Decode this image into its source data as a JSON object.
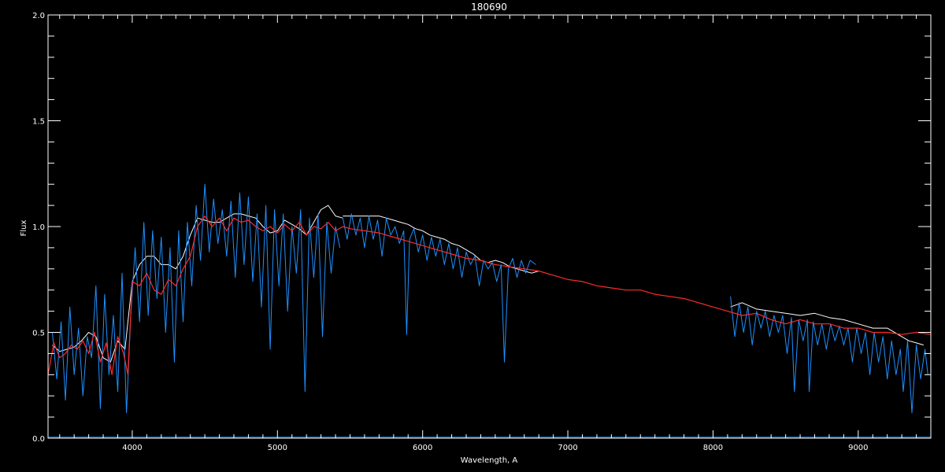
{
  "chart_data": {
    "type": "line",
    "title": "180690",
    "xlabel": "Wavelength, A",
    "ylabel": "Flux",
    "xlim": [
      3420,
      9500
    ],
    "ylim": [
      0.0,
      2.0
    ],
    "x_ticks": [
      4000,
      5000,
      6000,
      7000,
      8000,
      9000
    ],
    "x_tick_labels": [
      "4000",
      "5000",
      "6000",
      "7000",
      "8000",
      "9000"
    ],
    "y_ticks": [
      0.0,
      0.5,
      1.0,
      1.5,
      2.0
    ],
    "y_tick_labels": [
      "0.0",
      "0.5",
      "1.0",
      "1.5",
      "2.0"
    ],
    "background": "#000000",
    "axis_color": "#ffffff",
    "series": [
      {
        "color": "#ffffff",
        "segments": [
          {
            "x": [
              3450,
              3500,
              3550,
              3600,
              3650,
              3700,
              3750,
              3800,
              3850,
              3900,
              3950,
              4000,
              4050,
              4100,
              4150,
              4200,
              4250,
              4300,
              4350,
              4400,
              4450,
              4500,
              4550,
              4600,
              4650,
              4700,
              4750,
              4800,
              4850,
              4900,
              4950,
              5000,
              5050,
              5100,
              5150,
              5200,
              5250,
              5300,
              5350,
              5400,
              5450
            ],
            "y": [
              0.44,
              0.41,
              0.42,
              0.43,
              0.46,
              0.5,
              0.48,
              0.38,
              0.36,
              0.46,
              0.42,
              0.74,
              0.82,
              0.86,
              0.86,
              0.82,
              0.82,
              0.8,
              0.86,
              0.96,
              1.04,
              1.03,
              1.02,
              1.02,
              1.04,
              1.06,
              1.06,
              1.05,
              1.04,
              1.0,
              0.97,
              0.98,
              1.03,
              1.01,
              0.99,
              0.96,
              1.02,
              1.08,
              1.1,
              1.05,
              1.04
            ]
          },
          {
            "x": [
              5450,
              5500,
              5550,
              5600,
              5650,
              5700,
              5750,
              5800,
              5850,
              5900,
              5950,
              6000,
              6050,
              6100,
              6150,
              6200,
              6250,
              6300,
              6350,
              6400,
              6450,
              6500,
              6550,
              6600,
              6650,
              6700,
              6750,
              6800
            ],
            "y": [
              1.05,
              1.05,
              1.05,
              1.05,
              1.05,
              1.05,
              1.04,
              1.03,
              1.02,
              1.01,
              0.99,
              0.98,
              0.96,
              0.95,
              0.94,
              0.92,
              0.91,
              0.89,
              0.87,
              0.84,
              0.83,
              0.84,
              0.83,
              0.81,
              0.8,
              0.79,
              0.78,
              0.79
            ]
          },
          {
            "x": [
              8120,
              8200,
              8300,
              8400,
              8500,
              8600,
              8700,
              8800,
              8900,
              9000,
              9100,
              9200,
              9300,
              9350,
              9400,
              9450
            ],
            "y": [
              0.62,
              0.64,
              0.61,
              0.6,
              0.59,
              0.58,
              0.59,
              0.57,
              0.56,
              0.54,
              0.52,
              0.52,
              0.48,
              0.46,
              0.45,
              0.44
            ]
          }
        ]
      },
      {
        "color": "#1e90ff",
        "segments": [
          {
            "x": [
              3450,
              3480,
              3510,
              3540,
              3570,
              3600,
              3630,
              3660,
              3690,
              3720,
              3750,
              3780,
              3810,
              3840,
              3870,
              3900,
              3930,
              3960,
              3990,
              4020,
              4050,
              4080,
              4110,
              4140,
              4170,
              4200,
              4230,
              4260,
              4290,
              4320,
              4350,
              4380,
              4410,
              4440,
              4470,
              4500,
              4530,
              4560,
              4590,
              4620,
              4650,
              4680,
              4710,
              4740,
              4770,
              4800,
              4830,
              4860,
              4890,
              4920,
              4950,
              4980,
              5010,
              5040,
              5070,
              5100,
              5130,
              5160,
              5190,
              5220,
              5250,
              5280,
              5310,
              5340,
              5370,
              5400,
              5430
            ],
            "y": [
              0.5,
              0.28,
              0.55,
              0.18,
              0.62,
              0.3,
              0.52,
              0.2,
              0.48,
              0.38,
              0.72,
              0.14,
              0.68,
              0.3,
              0.58,
              0.22,
              0.78,
              0.12,
              0.58,
              0.9,
              0.55,
              1.02,
              0.58,
              0.98,
              0.66,
              0.95,
              0.5,
              0.9,
              0.36,
              0.98,
              0.55,
              1.02,
              0.72,
              1.1,
              0.84,
              1.2,
              0.88,
              1.13,
              0.92,
              1.08,
              0.86,
              1.12,
              0.76,
              1.16,
              0.82,
              1.14,
              0.74,
              1.06,
              0.62,
              1.1,
              0.42,
              1.08,
              0.72,
              1.06,
              0.6,
              1.0,
              0.78,
              1.08,
              0.22,
              1.04,
              0.76,
              1.06,
              0.48,
              1.02,
              0.78,
              1.0,
              0.9
            ]
          },
          {
            "x": [
              5450,
              5480,
              5510,
              5540,
              5570,
              5600,
              5630,
              5660,
              5690,
              5720,
              5750,
              5780,
              5810,
              5840,
              5870,
              5890,
              5910,
              5940,
              5970,
              6000,
              6030,
              6060,
              6090,
              6120,
              6150,
              6180,
              6210,
              6240,
              6270,
              6300,
              6330,
              6360,
              6390,
              6420,
              6450,
              6480,
              6510,
              6540,
              6563,
              6590,
              6620,
              6650,
              6680,
              6710,
              6740,
              6780
            ],
            "y": [
              1.04,
              0.94,
              1.06,
              0.96,
              1.04,
              0.9,
              1.05,
              0.94,
              1.03,
              0.86,
              1.04,
              0.96,
              1.0,
              0.92,
              0.98,
              0.49,
              0.94,
              0.99,
              0.88,
              0.96,
              0.84,
              0.95,
              0.86,
              0.94,
              0.82,
              0.92,
              0.8,
              0.9,
              0.76,
              0.88,
              0.82,
              0.86,
              0.72,
              0.84,
              0.8,
              0.83,
              0.74,
              0.82,
              0.36,
              0.8,
              0.85,
              0.76,
              0.84,
              0.78,
              0.84,
              0.82
            ]
          },
          {
            "x": [
              8120,
              8150,
              8180,
              8210,
              8240,
              8270,
              8300,
              8330,
              8360,
              8390,
              8420,
              8450,
              8480,
              8510,
              8540,
              8560,
              8590,
              8620,
              8650,
              8662,
              8690,
              8720,
              8750,
              8780,
              8810,
              8840,
              8870,
              8900,
              8930,
              8960,
              8990,
              9020,
              9050,
              9080,
              9110,
              9140,
              9170,
              9200,
              9230,
              9260,
              9290,
              9310,
              9340,
              9370,
              9400,
              9430,
              9460,
              9480
            ],
            "y": [
              0.67,
              0.48,
              0.64,
              0.5,
              0.62,
              0.44,
              0.6,
              0.52,
              0.6,
              0.48,
              0.58,
              0.5,
              0.58,
              0.4,
              0.57,
              0.22,
              0.56,
              0.46,
              0.56,
              0.22,
              0.55,
              0.44,
              0.54,
              0.42,
              0.54,
              0.46,
              0.53,
              0.44,
              0.52,
              0.36,
              0.52,
              0.4,
              0.5,
              0.3,
              0.5,
              0.36,
              0.48,
              0.28,
              0.46,
              0.3,
              0.42,
              0.22,
              0.46,
              0.12,
              0.44,
              0.28,
              0.42,
              0.3
            ]
          },
          {
            "x": [
              3420,
              9500
            ],
            "y": [
              0.005,
              0.005
            ]
          }
        ]
      },
      {
        "color": "#ff2a2a",
        "segments": [
          {
            "x": [
              3420,
              3460,
              3500,
              3540,
              3580,
              3620,
              3660,
              3700,
              3740,
              3780,
              3820,
              3860,
              3900,
              3940,
              3970,
              4000,
              4050,
              4100,
              4150,
              4200,
              4250,
              4300,
              4350,
              4400,
              4450,
              4500,
              4550,
              4600,
              4650,
              4700,
              4750,
              4800,
              4850,
              4900,
              4950,
              5000,
              5050,
              5100,
              5150,
              5200,
              5250,
              5300,
              5350,
              5400,
              5450,
              5500,
              5600,
              5700,
              5800,
              5900,
              6000,
              6100,
              6200,
              6300,
              6400,
              6500,
              6600,
              6700,
              6800,
              6900,
              7000,
              7100,
              7200,
              7300,
              7400,
              7500,
              7600,
              7700,
              7800,
              7900,
              8000,
              8100,
              8200,
              8300,
              8400,
              8500,
              8600,
              8700,
              8800,
              8900,
              9000,
              9100,
              9200,
              9300,
              9400,
              9500
            ],
            "y": [
              0.3,
              0.45,
              0.38,
              0.4,
              0.44,
              0.42,
              0.46,
              0.4,
              0.5,
              0.36,
              0.45,
              0.3,
              0.48,
              0.4,
              0.3,
              0.74,
              0.72,
              0.78,
              0.7,
              0.68,
              0.75,
              0.72,
              0.8,
              0.86,
              1.0,
              1.05,
              1.0,
              1.04,
              0.98,
              1.04,
              1.02,
              1.03,
              1.0,
              0.98,
              1.0,
              0.97,
              1.01,
              0.98,
              1.02,
              0.96,
              1.0,
              0.99,
              1.02,
              0.98,
              1.0,
              0.99,
              0.98,
              0.97,
              0.95,
              0.93,
              0.91,
              0.89,
              0.87,
              0.85,
              0.84,
              0.82,
              0.81,
              0.8,
              0.79,
              0.77,
              0.75,
              0.74,
              0.72,
              0.71,
              0.7,
              0.7,
              0.68,
              0.67,
              0.66,
              0.64,
              0.62,
              0.6,
              0.58,
              0.59,
              0.56,
              0.54,
              0.56,
              0.54,
              0.54,
              0.52,
              0.52,
              0.5,
              0.5,
              0.49,
              0.5,
              0.49
            ]
          }
        ]
      }
    ]
  }
}
